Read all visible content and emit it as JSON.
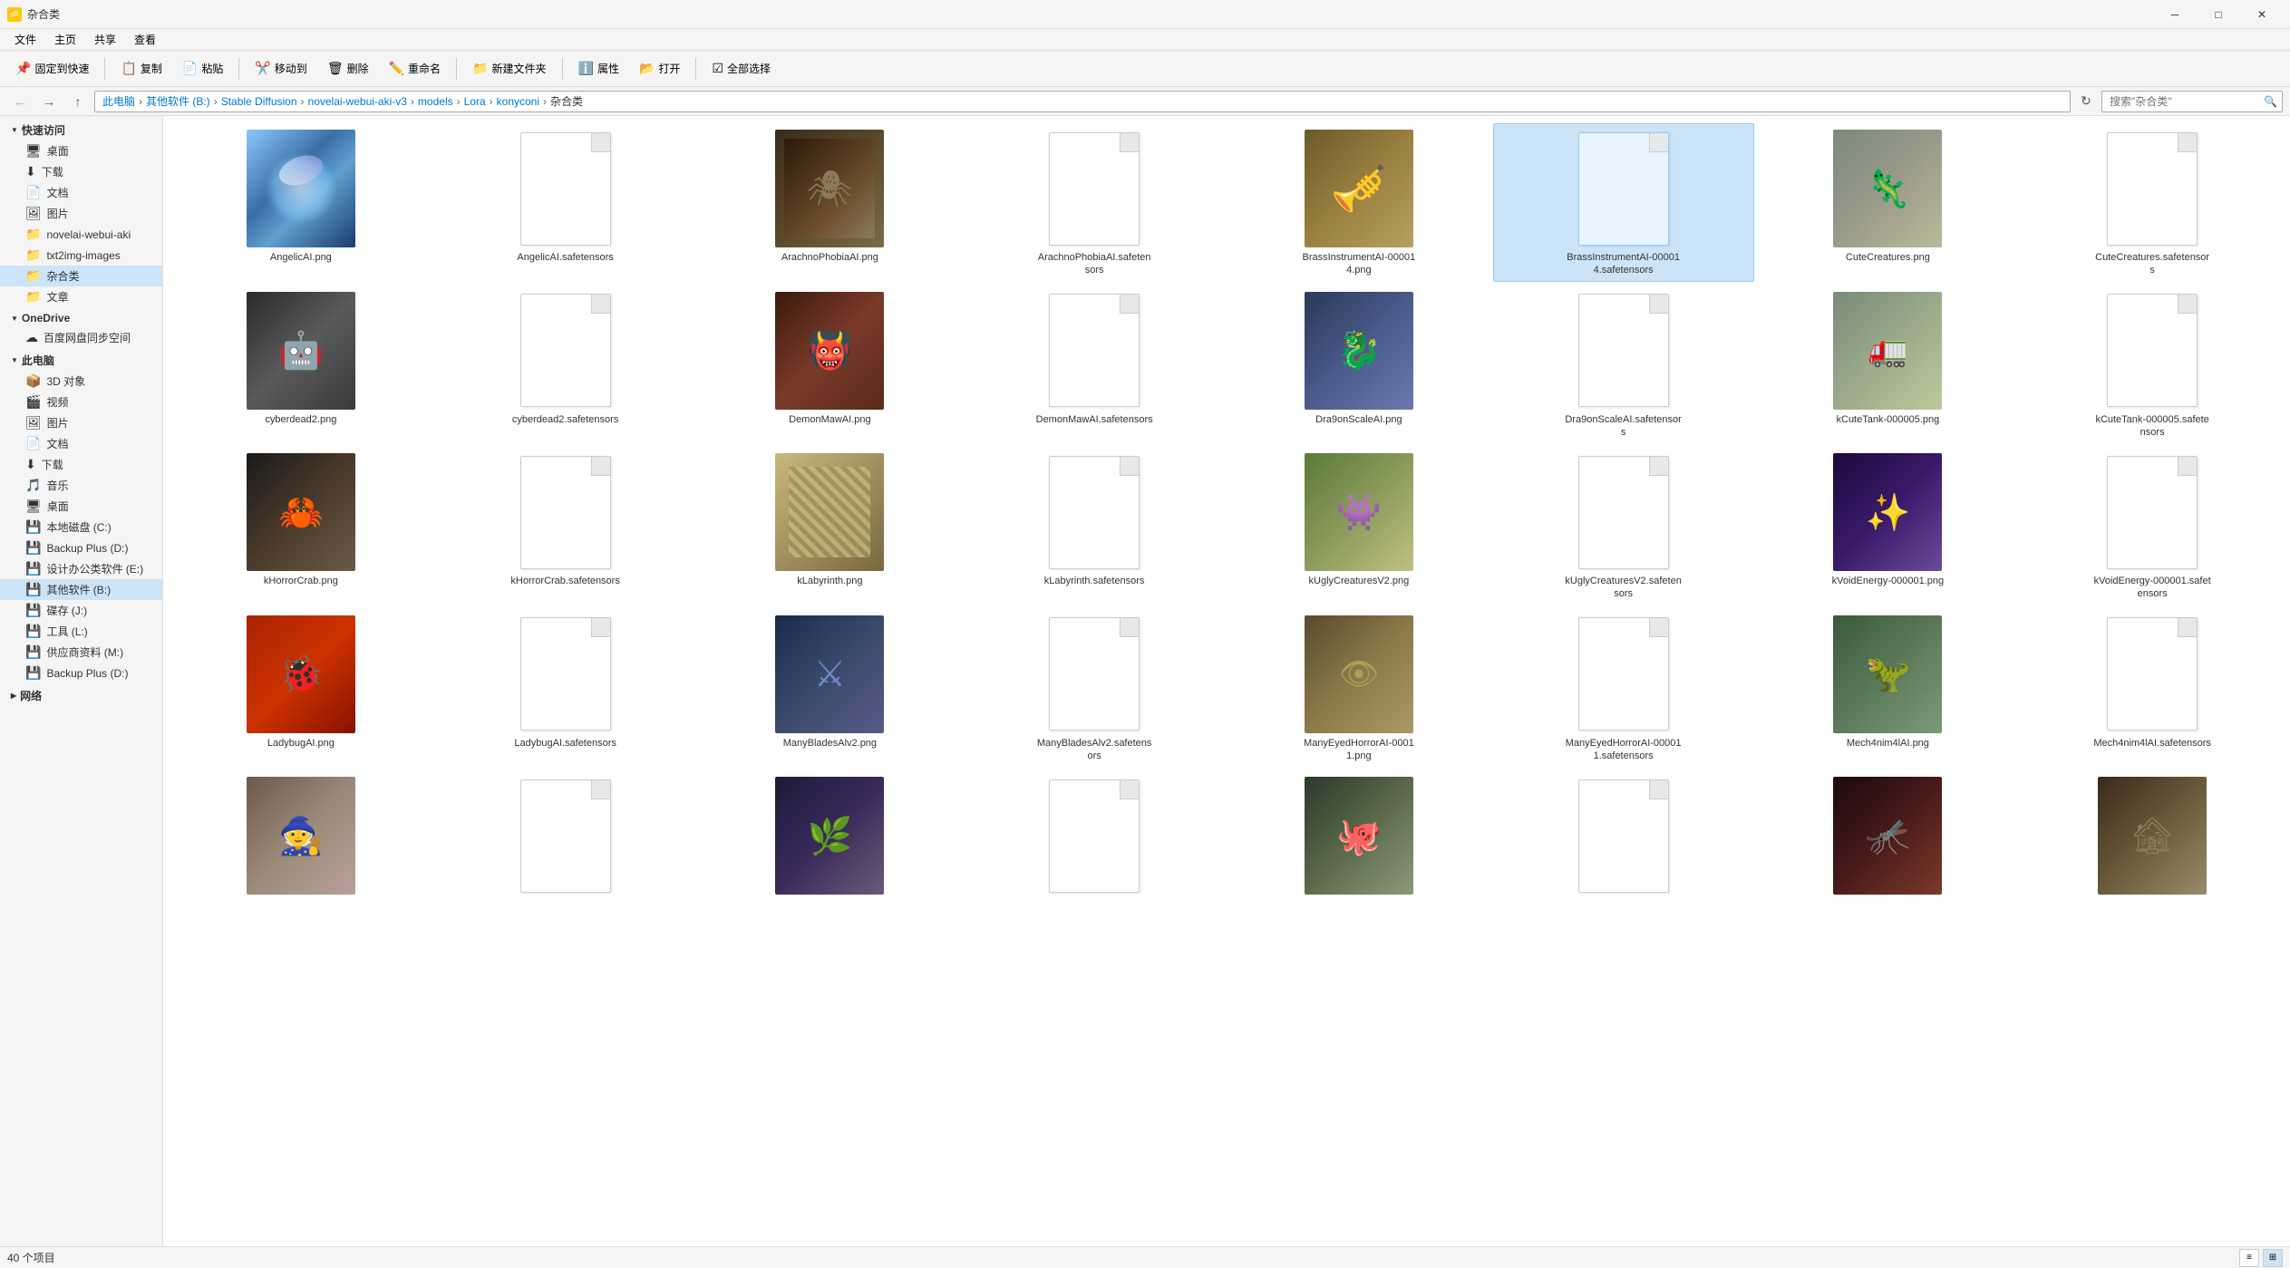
{
  "window": {
    "title": "杂合类",
    "controls": {
      "minimize": "─",
      "maximize": "□",
      "close": "✕"
    }
  },
  "menu": {
    "items": [
      "文件",
      "主页",
      "共享",
      "查看"
    ]
  },
  "toolbar": {
    "buttons": [
      {
        "id": "pin",
        "label": "固定到快速",
        "icon": "📌"
      },
      {
        "id": "copy",
        "label": "复制",
        "icon": "📋"
      },
      {
        "id": "paste",
        "label": "粘贴",
        "icon": "📄"
      },
      {
        "id": "move",
        "label": "移动到",
        "icon": "✂️"
      },
      {
        "id": "delete",
        "label": "删除",
        "icon": "🗑"
      },
      {
        "id": "rename",
        "label": "重命名",
        "icon": "✏️"
      },
      {
        "id": "newfolder",
        "label": "新建文件夹",
        "icon": "📁"
      },
      {
        "id": "properties",
        "label": "属性",
        "icon": "ℹ️"
      },
      {
        "id": "open",
        "label": "打开",
        "icon": "📂"
      },
      {
        "id": "select",
        "label": "全部选择",
        "icon": "☑"
      }
    ]
  },
  "addressbar": {
    "crumbs": [
      "此电脑",
      "其他软件 (B:)",
      "Stable Diffusion",
      "novelai-webui-aki-v3",
      "models",
      "Lora",
      "konyconi",
      "杂合类"
    ],
    "search_placeholder": "搜索\"杂合类\""
  },
  "sidebar": {
    "quick_access_label": "快速访问",
    "quick_access_items": [
      {
        "label": "桌面",
        "icon": "🖥"
      },
      {
        "label": "下载",
        "icon": "⬇"
      },
      {
        "label": "文档",
        "icon": "📄"
      },
      {
        "label": "图片",
        "icon": "🖼"
      },
      {
        "label": "novelai-webui-aki",
        "icon": "📁"
      },
      {
        "label": "txt2img-images",
        "icon": "📁"
      },
      {
        "label": "杂合类",
        "icon": "📁",
        "active": true
      },
      {
        "label": "文章",
        "icon": "📁"
      }
    ],
    "onedrive_label": "OneDrive",
    "onedrive_items": [
      {
        "label": "百度网盘同步空间",
        "icon": "☁"
      }
    ],
    "thispc_label": "此电脑",
    "thispc_items": [
      {
        "label": "3D 对象",
        "icon": "📦"
      },
      {
        "label": "视频",
        "icon": "🎬"
      },
      {
        "label": "图片",
        "icon": "🖼"
      },
      {
        "label": "文档",
        "icon": "📄"
      },
      {
        "label": "下载",
        "icon": "⬇"
      },
      {
        "label": "音乐",
        "icon": "🎵"
      },
      {
        "label": "桌面",
        "icon": "🖥"
      },
      {
        "label": "本地磁盘 (C:)",
        "icon": "💾"
      },
      {
        "label": "Backup Plus (D:)",
        "icon": "💾"
      },
      {
        "label": "设计办公类软件 (E:)",
        "icon": "💾"
      },
      {
        "label": "其他软件 (B:)",
        "icon": "💾",
        "active": true
      },
      {
        "label": "碟存 (J:)",
        "icon": "💾"
      },
      {
        "label": "工具 (L:)",
        "icon": "💾"
      },
      {
        "label": "供应商资料 (M:)",
        "icon": "💾"
      },
      {
        "label": "Backup Plus (D:)",
        "icon": "💾"
      }
    ],
    "network_label": "网络"
  },
  "files": [
    {
      "id": "f1",
      "name": "AngelicAI.png",
      "type": "image",
      "style": "angelic"
    },
    {
      "id": "f2",
      "name": "AngelicAI.safetensors",
      "type": "blank"
    },
    {
      "id": "f3",
      "name": "ArachnoPhobiaAI.png",
      "type": "image",
      "style": "arachnophobia"
    },
    {
      "id": "f4",
      "name": "ArachnoPhobiaAI.safetensors",
      "type": "blank"
    },
    {
      "id": "f5",
      "name": "BrassInstrumentAI-000014.png",
      "type": "image",
      "style": "brassinstrument"
    },
    {
      "id": "f6",
      "name": "BrassInstrumentAI-000014.safetensors",
      "type": "blank",
      "selected": true
    },
    {
      "id": "f7",
      "name": "CuteCreatures.png",
      "type": "image",
      "style": "cutecreatures"
    },
    {
      "id": "f8",
      "name": "CuteCreatures.safetensors",
      "type": "blank"
    },
    {
      "id": "f9",
      "name": "cyberdead2.png",
      "type": "image",
      "style": "cyberdead"
    },
    {
      "id": "f10",
      "name": "cyberdead2.safetensors",
      "type": "blank"
    },
    {
      "id": "f11",
      "name": "DemonMawAI.png",
      "type": "image",
      "style": "demonmaw"
    },
    {
      "id": "f12",
      "name": "DemonMawAI.safetensors",
      "type": "blank"
    },
    {
      "id": "f13",
      "name": "Dra9onScaleAI.png",
      "type": "image",
      "style": "dragon"
    },
    {
      "id": "f14",
      "name": "Dra9onScaleAI.safetensors",
      "type": "blank"
    },
    {
      "id": "f15",
      "name": "kCuteTank-000005.png",
      "type": "image",
      "style": "cutecreatures"
    },
    {
      "id": "f16",
      "name": "kCuteTank-000005.safetensors",
      "type": "blank"
    },
    {
      "id": "f17",
      "name": "kHorrorCrab.png",
      "type": "image",
      "style": "khorror"
    },
    {
      "id": "f18",
      "name": "kHorrorCrab.safetensors",
      "type": "blank"
    },
    {
      "id": "f19",
      "name": "kLabyrinth.png",
      "type": "image",
      "style": "klabyrinth"
    },
    {
      "id": "f20",
      "name": "kLabyrinth.safetensors",
      "type": "blank"
    },
    {
      "id": "f21",
      "name": "kUglyCreaturesV2.png",
      "type": "image",
      "style": "kugly"
    },
    {
      "id": "f22",
      "name": "kUglyCreaturesV2.safetensors",
      "type": "blank"
    },
    {
      "id": "f23",
      "name": "kVoidEnergy-000001.png",
      "type": "image",
      "style": "kvoid"
    },
    {
      "id": "f24",
      "name": "kVoidEnergy-000001.safetensors",
      "type": "blank"
    },
    {
      "id": "f25",
      "name": "LadybugAI.png",
      "type": "image",
      "style": "ladybug"
    },
    {
      "id": "f26",
      "name": "LadybugAI.safetensors",
      "type": "blank"
    },
    {
      "id": "f27",
      "name": "ManyBladesAlv2.png",
      "type": "image",
      "style": "manyblades"
    },
    {
      "id": "f28",
      "name": "ManyBladesAlv2.safetensors",
      "type": "blank"
    },
    {
      "id": "f29",
      "name": "ManyEyedHorrorAI-00011.png",
      "type": "image",
      "style": "manyeyed"
    },
    {
      "id": "f30",
      "name": "ManyEyedHorrorAI-000011.safetensors",
      "type": "blank"
    },
    {
      "id": "f31",
      "name": "Mech4nim4lAI.png",
      "type": "image",
      "style": "mech4nim"
    },
    {
      "id": "f32",
      "name": "Mech4nim4lAI.safetensors",
      "type": "blank"
    },
    {
      "id": "f33",
      "name": "",
      "type": "image",
      "style": "row5a"
    },
    {
      "id": "f34",
      "name": "",
      "type": "blank"
    },
    {
      "id": "f35",
      "name": "",
      "type": "image",
      "style": "row5b"
    },
    {
      "id": "f36",
      "name": "",
      "type": "blank"
    },
    {
      "id": "f37",
      "name": "",
      "type": "image",
      "style": "row5c"
    },
    {
      "id": "f38",
      "name": "",
      "type": "blank"
    },
    {
      "id": "f39",
      "name": "",
      "type": "image",
      "style": "row5d"
    },
    {
      "id": "f40",
      "name": "",
      "type": "image",
      "style": "row5e"
    }
  ],
  "statusbar": {
    "count_label": "40 个项目"
  }
}
